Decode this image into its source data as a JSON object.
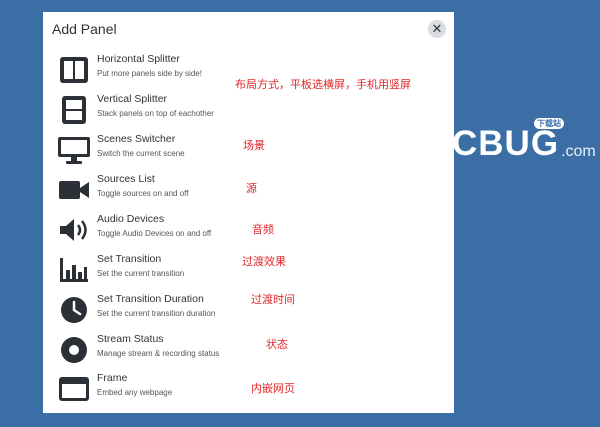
{
  "watermark": {
    "brand": "CBUG",
    "tld": ".com",
    "badge": "下载站"
  },
  "dialog": {
    "title": "Add Panel",
    "close_glyph": "✕",
    "items": [
      {
        "name": "Horizontal Splitter",
        "desc": "Put more panels side by side!",
        "icon": "horizontal-splitter-icon",
        "note": "布局方式，平板选横屏，手机用竖屏"
      },
      {
        "name": "Vertical Splitter",
        "desc": "Stack panels on top of eachother",
        "icon": "vertical-splitter-icon",
        "note": ""
      },
      {
        "name": "Scenes Switcher",
        "desc": "Switch the current scene",
        "icon": "monitor-icon",
        "note": "场景"
      },
      {
        "name": "Sources List",
        "desc": "Toggle sources on and off",
        "icon": "video-camera-icon",
        "note": "源"
      },
      {
        "name": "Audio Devices",
        "desc": "Toggle Audio Devices on and off",
        "icon": "speaker-icon",
        "note": "音频"
      },
      {
        "name": "Set Transition",
        "desc": "Set the current transition",
        "icon": "bar-chart-icon",
        "note": "过渡效果"
      },
      {
        "name": "Set Transition Duration",
        "desc": "Set the current transition duration",
        "icon": "clock-icon",
        "note": "过渡时间"
      },
      {
        "name": "Stream Status",
        "desc": "Manage stream & recording status",
        "icon": "record-icon",
        "note": "状态"
      },
      {
        "name": "Frame",
        "desc": "Embed any webpage",
        "icon": "browser-window-icon",
        "note": "内嵌网页"
      }
    ]
  },
  "colors": {
    "background": "#3a6ea5",
    "icon": "#2b2f36",
    "note": "#e0282b"
  }
}
